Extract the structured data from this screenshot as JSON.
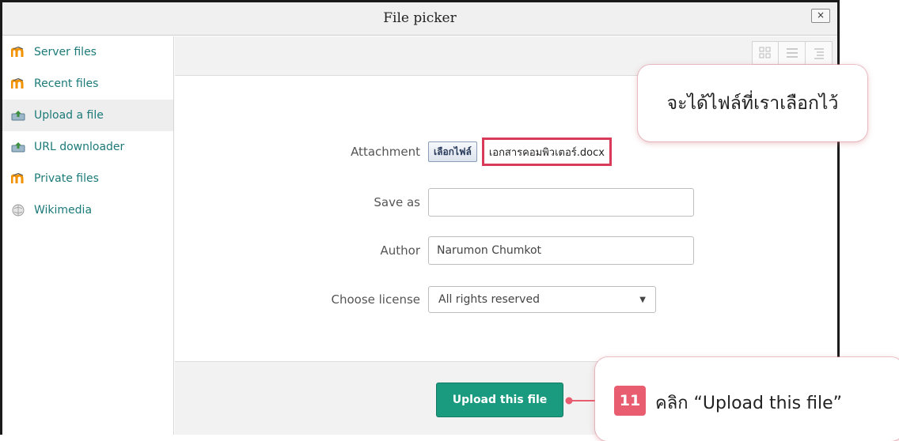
{
  "window": {
    "title": "File picker",
    "close_label": "×"
  },
  "sidebar": {
    "items": [
      {
        "label": "Server files",
        "icon": "moodle-icon"
      },
      {
        "label": "Recent files",
        "icon": "moodle-icon"
      },
      {
        "label": "Upload a file",
        "icon": "upload-icon",
        "active": true
      },
      {
        "label": "URL downloader",
        "icon": "upload-icon"
      },
      {
        "label": "Private files",
        "icon": "moodle-icon"
      },
      {
        "label": "Wikimedia",
        "icon": "wikimedia-icon"
      }
    ]
  },
  "toolbar": {
    "views": [
      "icons-view-icon",
      "list-view-icon",
      "tree-view-icon"
    ]
  },
  "form": {
    "attachment_label": "Attachment",
    "choose_file_label": "เลือกไฟล์",
    "selected_file": "เอกสารคอมพิวเตอร์.docx",
    "save_as_label": "Save as",
    "save_as_value": "",
    "author_label": "Author",
    "author_value": "Narumon Chumkot",
    "license_label": "Choose license",
    "license_value": "All rights reserved"
  },
  "footer": {
    "upload_label": "Upload this file"
  },
  "annotations": {
    "top_callout": "จะได้ไฟล์ที่เราเลือกไว้",
    "step_number": "11",
    "step_text": "คลิก “Upload this file”"
  },
  "colors": {
    "accent": "#1a9a7e",
    "link": "#1b7a78",
    "highlight": "#d93a5a",
    "badge": "#e85d6f"
  }
}
